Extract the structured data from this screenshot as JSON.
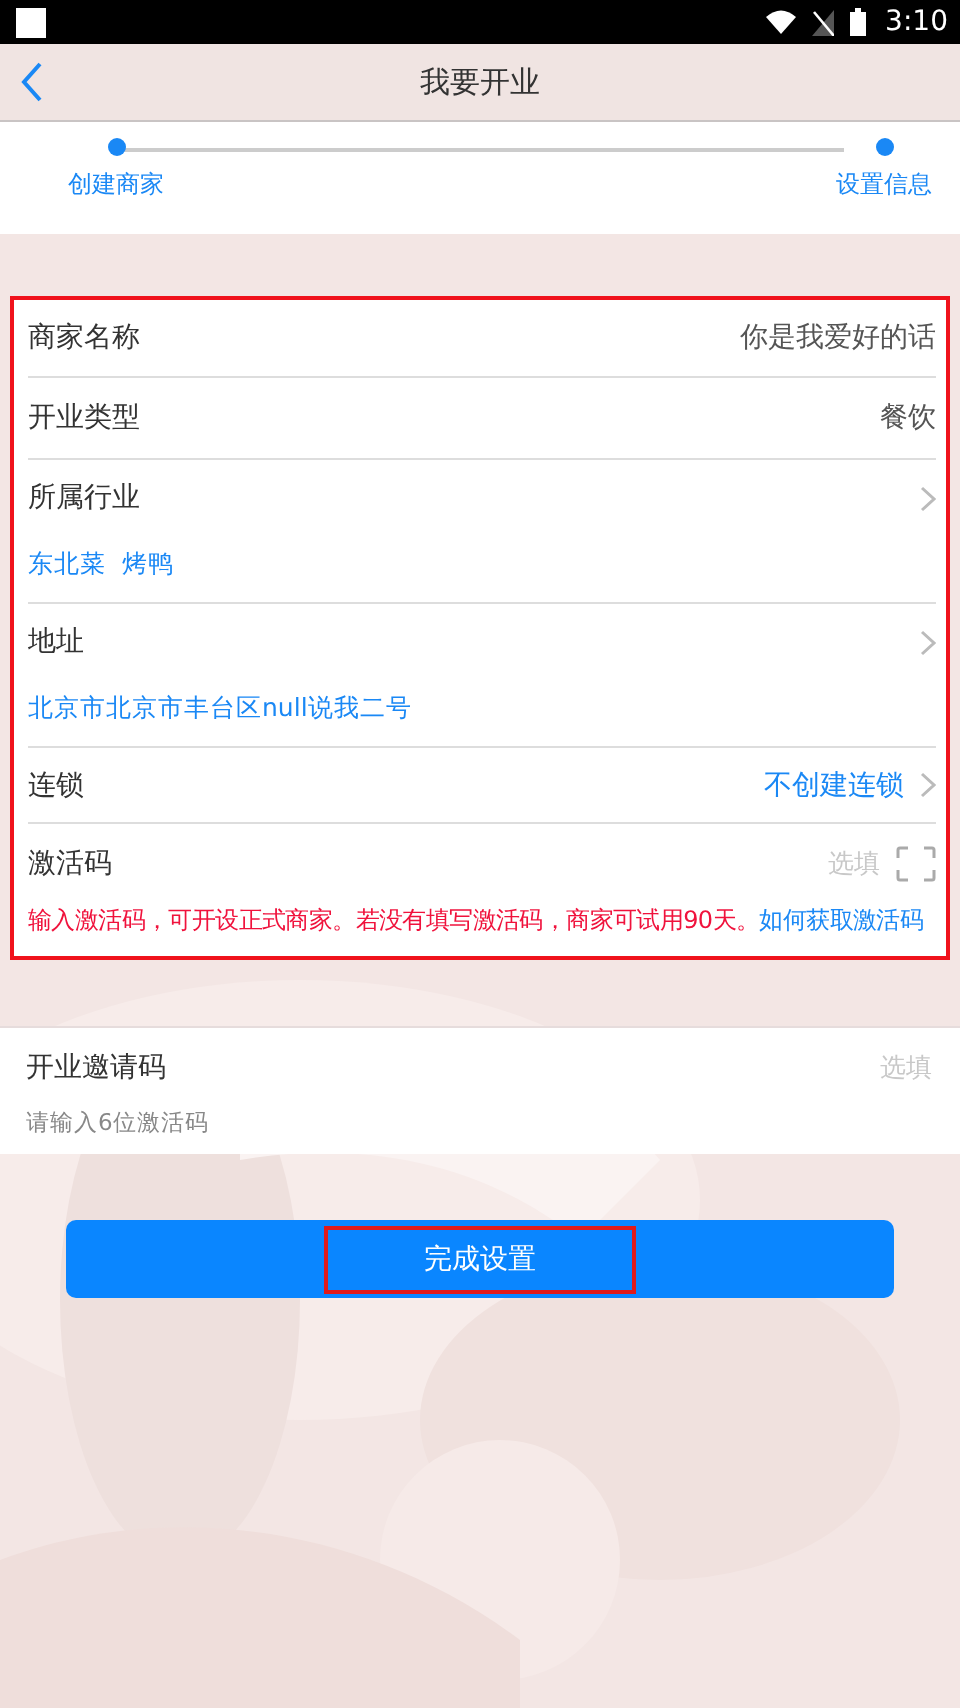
{
  "status_bar": {
    "time": "3:10"
  },
  "header": {
    "title": "我要开业"
  },
  "steps": [
    {
      "label": "创建商家",
      "done": true
    },
    {
      "label": "设置信息",
      "done": true
    }
  ],
  "form": {
    "highlighted": true,
    "rows": [
      {
        "kind": "text",
        "label": "商家名称",
        "value": "你是我爱好的话"
      },
      {
        "kind": "text",
        "label": "开业类型",
        "value": "餐饮"
      },
      {
        "kind": "detail",
        "label": "所属行业",
        "tags": [
          "东北菜",
          "烤鸭"
        ]
      },
      {
        "kind": "detail",
        "label": "地址",
        "tags": [
          "北京市北京市丰台区null说我二号"
        ]
      },
      {
        "kind": "link",
        "label": "连锁",
        "value": "不创建连锁"
      },
      {
        "kind": "code",
        "label": "激活码",
        "placeholder": "选填",
        "notice": "输入激活码，可开设正式商家。若没有填写激活码，商家可试用90天。",
        "help_link": "如何获取激活码"
      }
    ]
  },
  "invite": {
    "label": "开业邀请码",
    "placeholder": "选填",
    "hint": "请输入6位激活码"
  },
  "submit": {
    "label": "完成设置",
    "highlighted": true
  }
}
